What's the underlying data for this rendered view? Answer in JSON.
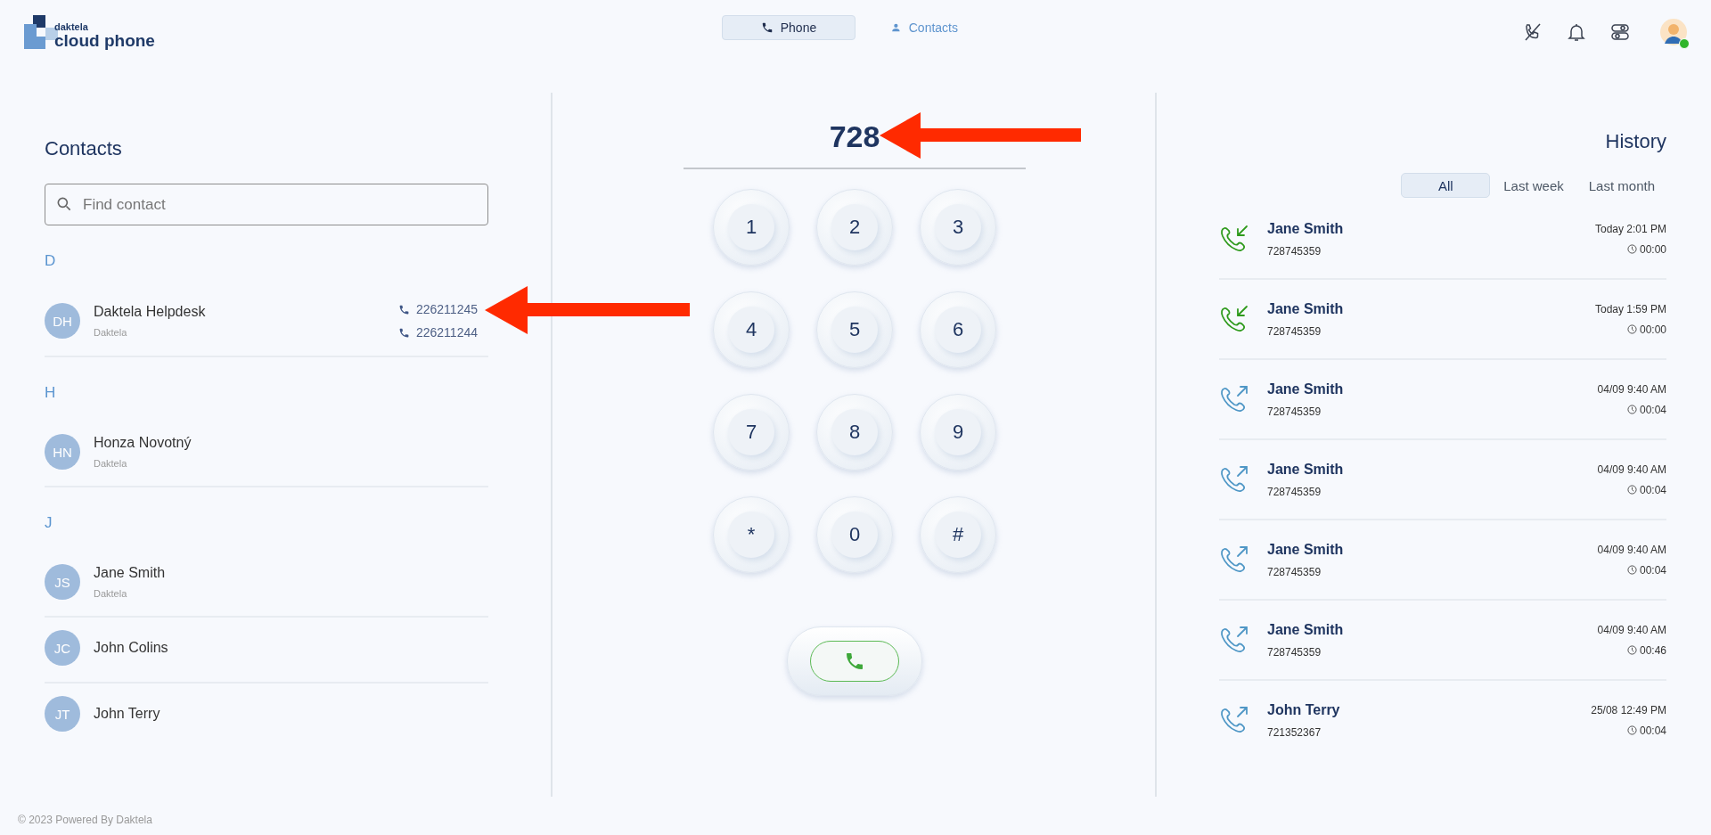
{
  "logo": {
    "brand": "daktela",
    "product": "cloud phone"
  },
  "nav_tabs": [
    {
      "label": "Phone",
      "selected": true
    },
    {
      "label": "Contacts",
      "selected": false
    }
  ],
  "user": {
    "online": true
  },
  "contacts": {
    "title": "Contacts",
    "search": {
      "placeholder": "Find contact"
    },
    "groups": [
      {
        "letter": "D",
        "items": [
          {
            "initials": "DH",
            "name": "Daktela Helpdesk",
            "company": "Daktela",
            "phones": [
              "226211245",
              "226211244"
            ]
          }
        ]
      },
      {
        "letter": "H",
        "items": [
          {
            "initials": "HN",
            "name": "Honza Novotný",
            "company": "Daktela"
          }
        ]
      },
      {
        "letter": "J",
        "items": [
          {
            "initials": "JS",
            "name": "Jane Smith",
            "company": "Daktela"
          },
          {
            "initials": "JC",
            "name": "John Colins"
          },
          {
            "initials": "JT",
            "name": "John Terry"
          }
        ]
      }
    ]
  },
  "dialer": {
    "number": "728",
    "keys": [
      "1",
      "2",
      "3",
      "4",
      "5",
      "6",
      "7",
      "8",
      "9",
      "*",
      "0",
      "#"
    ]
  },
  "history": {
    "title": "History",
    "filters": [
      {
        "label": "All",
        "selected": true
      },
      {
        "label": "Last week",
        "selected": false
      },
      {
        "label": "Last month",
        "selected": false
      }
    ],
    "calls": [
      {
        "kind": "incoming",
        "name": "Jane Smith",
        "number": "728745359",
        "time": "Today 2:01 PM",
        "duration": "00:00"
      },
      {
        "kind": "incoming",
        "name": "Jane Smith",
        "number": "728745359",
        "time": "Today 1:59 PM",
        "duration": "00:00"
      },
      {
        "kind": "outgoing",
        "name": "Jane Smith",
        "number": "728745359",
        "time": "04/09 9:40 AM",
        "duration": "00:04"
      },
      {
        "kind": "outgoing",
        "name": "Jane Smith",
        "number": "728745359",
        "time": "04/09 9:40 AM",
        "duration": "00:04"
      },
      {
        "kind": "outgoing",
        "name": "Jane Smith",
        "number": "728745359",
        "time": "04/09 9:40 AM",
        "duration": "00:04"
      },
      {
        "kind": "outgoing",
        "name": "Jane Smith",
        "number": "728745359",
        "time": "04/09 9:40 AM",
        "duration": "00:46"
      },
      {
        "kind": "outgoing",
        "name": "John Terry",
        "number": "721352367",
        "time": "25/08 12:49 PM",
        "duration": "00:04"
      }
    ]
  },
  "annotation_arrows": {
    "dialed_number": true,
    "first_phone": true
  },
  "footer": "© 2023 Powered By Daktela"
}
